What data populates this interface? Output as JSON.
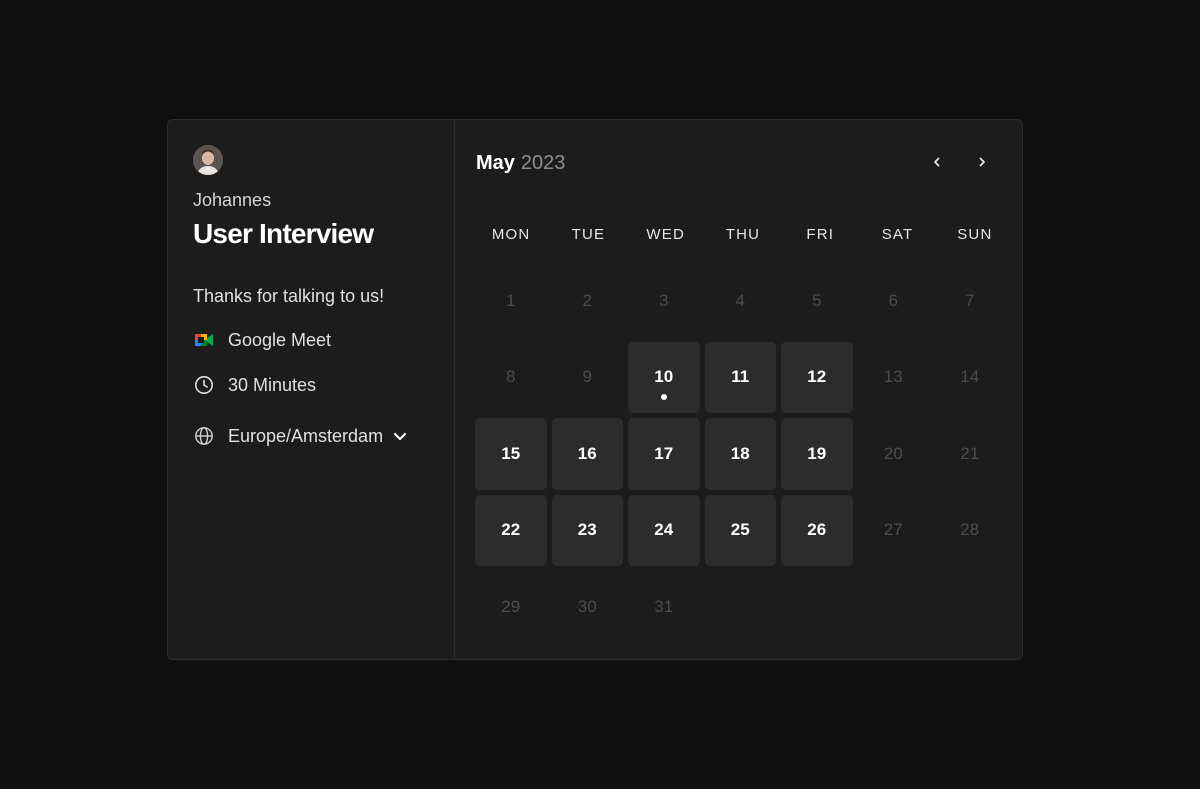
{
  "event": {
    "host_name": "Johannes",
    "title": "User Interview",
    "description": "Thanks for talking to us!",
    "location": "Google Meet",
    "duration": "30 Minutes",
    "timezone": "Europe/Amsterdam"
  },
  "calendar": {
    "month": "May",
    "year": "2023",
    "weekdays": [
      "MON",
      "TUE",
      "WED",
      "THU",
      "FRI",
      "SAT",
      "SUN"
    ],
    "days": [
      {
        "label": "1",
        "available": false
      },
      {
        "label": "2",
        "available": false
      },
      {
        "label": "3",
        "available": false
      },
      {
        "label": "4",
        "available": false
      },
      {
        "label": "5",
        "available": false
      },
      {
        "label": "6",
        "available": false
      },
      {
        "label": "7",
        "available": false
      },
      {
        "label": "8",
        "available": false
      },
      {
        "label": "9",
        "available": false
      },
      {
        "label": "10",
        "available": true,
        "today": true
      },
      {
        "label": "11",
        "available": true
      },
      {
        "label": "12",
        "available": true
      },
      {
        "label": "13",
        "available": false
      },
      {
        "label": "14",
        "available": false
      },
      {
        "label": "15",
        "available": true
      },
      {
        "label": "16",
        "available": true
      },
      {
        "label": "17",
        "available": true
      },
      {
        "label": "18",
        "available": true
      },
      {
        "label": "19",
        "available": true
      },
      {
        "label": "20",
        "available": false
      },
      {
        "label": "21",
        "available": false
      },
      {
        "label": "22",
        "available": true
      },
      {
        "label": "23",
        "available": true
      },
      {
        "label": "24",
        "available": true
      },
      {
        "label": "25",
        "available": true
      },
      {
        "label": "26",
        "available": true
      },
      {
        "label": "27",
        "available": false
      },
      {
        "label": "28",
        "available": false
      },
      {
        "label": "29",
        "available": false
      },
      {
        "label": "30",
        "available": false
      },
      {
        "label": "31",
        "available": false
      }
    ]
  },
  "icons": {
    "location": "google-meet-icon",
    "duration": "clock-icon",
    "timezone": "globe-icon",
    "timezone_toggle": "chevron-down-icon",
    "prev": "chevron-left-icon",
    "next": "chevron-right-icon"
  },
  "colors": {
    "background": "#101010",
    "card": "#1c1c1c",
    "available_day": "#2c2c2c",
    "unavailable_text": "#4d4d4d"
  }
}
